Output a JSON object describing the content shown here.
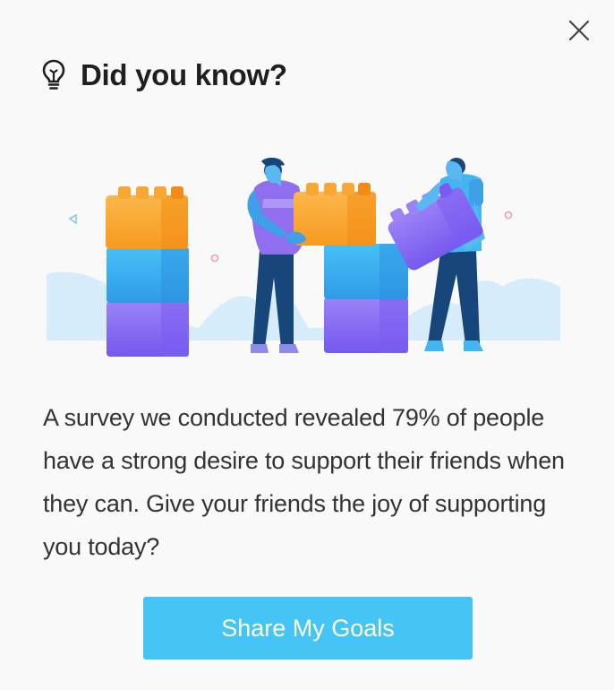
{
  "dialog": {
    "title": "Did you know?",
    "body": "A survey we conducted revealed 79% of people have a strong desire to support their friends when they can. Give your friends the joy of supporting you today?",
    "cta_label": "Share My Goals"
  },
  "icons": {
    "header": "lightbulb-icon",
    "close": "close-icon"
  },
  "colors": {
    "accent": "#44c5f5",
    "block_orange": "#f7a028",
    "block_blue": "#3aaef0",
    "block_purple": "#8a6af5",
    "person_purple": "#8f6ef0",
    "person_blue": "#43b6f2",
    "pants": "#17477a",
    "hill": "#d6ecfa"
  }
}
